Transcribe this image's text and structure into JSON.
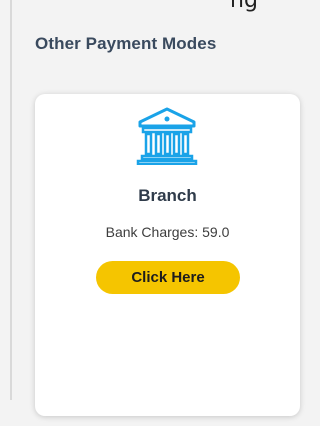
{
  "header_fragment": "ng",
  "section": {
    "title": "Other Payment Modes"
  },
  "card": {
    "icon": "bank-building-icon",
    "title": "Branch",
    "charges_text": "Bank Charges: 59.0",
    "button_label": "Click Here"
  },
  "colors": {
    "accent": "#1aa3e8",
    "button": "#f5c500",
    "title_text": "#3a4a5e"
  }
}
